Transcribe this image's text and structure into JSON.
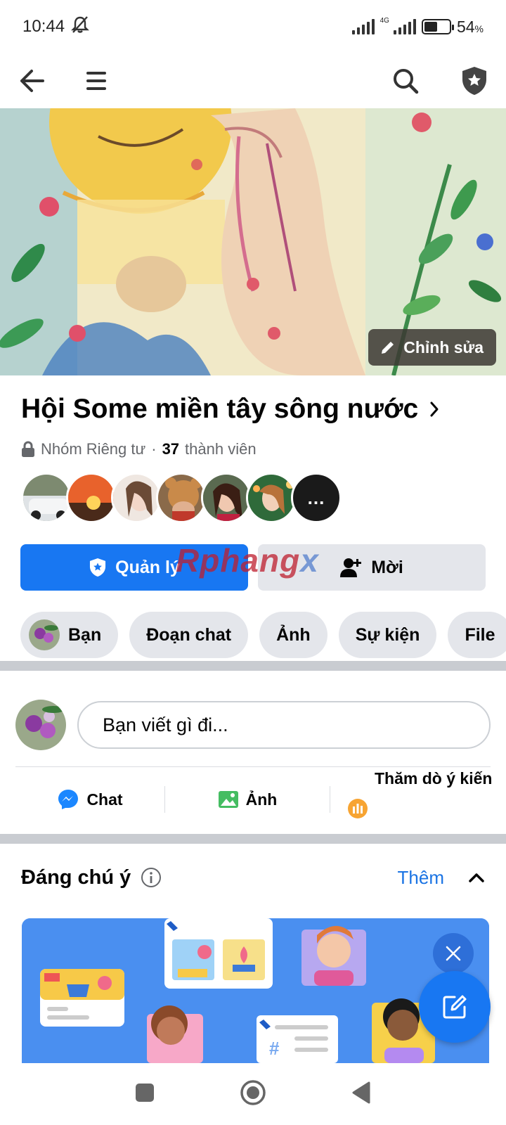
{
  "status": {
    "time": "10:44",
    "network": "4G",
    "battery_level": 0.54,
    "battery_percent": "54",
    "percent_sign": "%"
  },
  "cover": {
    "edit_label": "Chỉnh sửa"
  },
  "group": {
    "name": "Hội Some miền tây sông nước",
    "privacy": "Nhóm Riêng tư",
    "separator": "·",
    "member_count": "37",
    "member_label": "thành viên"
  },
  "members": {
    "more": "..."
  },
  "buttons": {
    "manage": "Quản lý",
    "invite": "Mời"
  },
  "watermark": {
    "a": "Rphang",
    "b": "x"
  },
  "chips": [
    "Bạn",
    "Đoạn chat",
    "Ảnh",
    "Sự kiện",
    "File"
  ],
  "composer": {
    "placeholder": "Bạn viết gì đi..."
  },
  "actions": {
    "chat": "Chat",
    "photo": "Ảnh",
    "poll": "Thăm dò ý kiến"
  },
  "highlights": {
    "title": "Đáng chú ý",
    "more": "Thêm"
  },
  "colors": {
    "brand": "#1877f2",
    "chip_bg": "#e4e6eb",
    "secondary_text": "#65676b"
  }
}
